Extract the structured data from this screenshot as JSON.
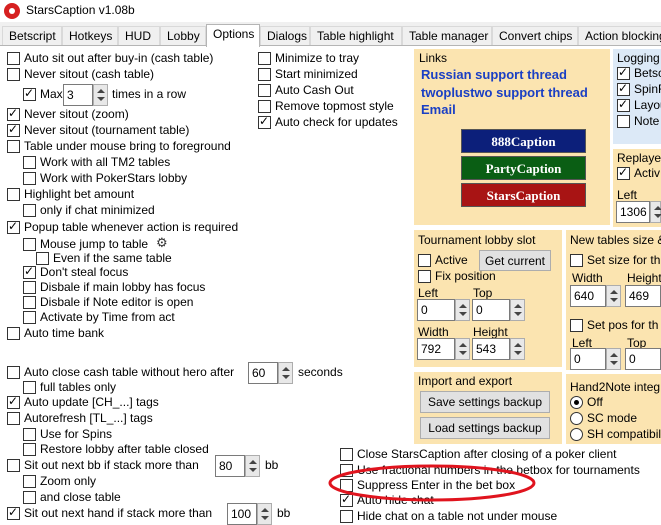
{
  "window": {
    "title": "StarsCaption v1.08b"
  },
  "tabs": [
    {
      "label": "Betscript"
    },
    {
      "label": "Hotkeys"
    },
    {
      "label": "HUD"
    },
    {
      "label": "Lobby"
    },
    {
      "label": "Options"
    },
    {
      "label": "Dialogs"
    },
    {
      "label": "Table highlight"
    },
    {
      "label": "Table manager"
    },
    {
      "label": "Convert chips"
    },
    {
      "label": "Action blocking"
    }
  ],
  "left": {
    "auto_sit_out": "Auto sit out after buy-in (cash table)",
    "never_sitout_cash": "Never sitout (cash table)",
    "max_label": "Max",
    "max_value": "3",
    "times_in_row": "times in a row",
    "never_sitout_zoom": "Never sitout (zoom)",
    "never_sitout_tournament": "Never sitout (tournament table)",
    "table_under_mouse": "Table under mouse bring to foreground",
    "work_tm2": "Work with all TM2 tables",
    "work_pokerstars": "Work with PokerStars lobby",
    "highlight_bet": "Highlight bet amount",
    "only_chat_min": "only if chat minimized",
    "popup_table": "Popup table whenever action is required",
    "mouse_jump": "Mouse jump to table",
    "even_same_table": "Even if the same table",
    "dont_steal_focus": "Don't steal focus",
    "disable_main_lobby": "Disbale if main lobby has focus",
    "disable_note_editor": "Disbale if Note editor is open",
    "activate_by_time": "Activate by Time from act",
    "auto_time_bank": "Auto time bank",
    "auto_close_cash": "Auto close cash table without hero after",
    "auto_close_value": "60",
    "seconds": "seconds",
    "full_tables_only": "full tables only",
    "auto_update": "Auto update [CH_...] tags",
    "autorefresh": "Autorefresh [TL_...] tags",
    "use_for_spins": "Use for Spins",
    "restore_lobby": "Restore lobby after table closed",
    "sit_out_next_bb": "Sit out next bb if stack more than",
    "sit_out_bb_value": "80",
    "bb1": "bb",
    "zoom_only": "Zoom only",
    "and_close_table": "and close table",
    "sit_out_next_hand": "Sit out next hand if stack more than",
    "sit_out_hand_value": "100",
    "bb2": "bb"
  },
  "middle": {
    "minimize_tray": "Minimize to tray",
    "start_minimized": "Start minimized",
    "auto_cash_out": "Auto Cash Out",
    "remove_topmost": "Remove topmost style",
    "auto_check_updates": "Auto check for updates"
  },
  "links": {
    "title": "Links",
    "russian": "Russian support thread",
    "twoplustwo": "twoplustwo support thread",
    "email": "Email",
    "btn_888": "888Caption",
    "btn_party": "PartyCaption",
    "btn_stars": "StarsCaption",
    "color_888": "#0c1f7a",
    "color_party": "#0a5e14",
    "color_stars": "#a81414"
  },
  "logging": {
    "title": "Logging",
    "items": [
      "Betsc",
      "SpinR",
      "Layou",
      "Note"
    ]
  },
  "replayer": {
    "title": "Replayer",
    "active": "Activ",
    "left_label": "Left",
    "left_value": "1306"
  },
  "tournament_lobby": {
    "title": "Tournament lobby slot",
    "active": "Active",
    "get_current": "Get current",
    "fix_position": "Fix position",
    "left_label": "Left",
    "left_value": "0",
    "top_label": "Top",
    "top_value": "0",
    "width_label": "Width",
    "width_value": "792",
    "height_label": "Height",
    "height_value": "543"
  },
  "new_tables": {
    "title": "New tables size &",
    "set_size": "Set size for th",
    "width_label": "Width",
    "width_value": "640",
    "height_label": "Height",
    "height_value": "469",
    "set_pos": "Set pos for th",
    "left_label": "Left",
    "left_value": "0",
    "top_label": "Top",
    "top_value": "0"
  },
  "import_export": {
    "title": "Import and export",
    "save": "Save settings backup",
    "load": "Load settings backup"
  },
  "hand2note": {
    "title": "Hand2Note integ",
    "off": "Off",
    "sc_mode": "SC mode",
    "sh_compat": "SH compatibili"
  },
  "bottom": {
    "close_stars": "Close StarsCaption after closing of a poker client",
    "fractional": "Use fractional numbers in the betbox for tournaments",
    "suppress_enter": "Suppress Enter in the bet box",
    "auto_hide_chat": "Auto hide chat",
    "hide_chat": "Hide chat on a table not under mouse"
  },
  "colors": {
    "panel_bg": "#fbe4b0",
    "annotation": "#e0141e",
    "link": "#1a3fc4"
  }
}
